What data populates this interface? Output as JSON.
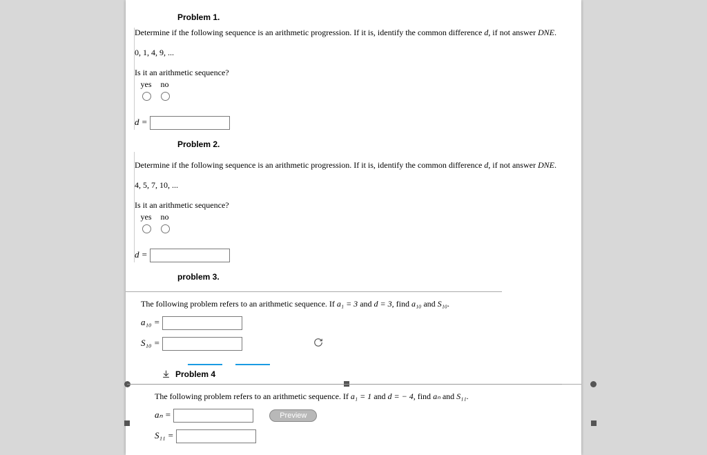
{
  "problem1": {
    "heading": "Problem 1.",
    "text_a": "Determine if the following sequence is an arithmetic progression. If it is, identify the common difference ",
    "d": "d",
    "text_b": ", if not answer ",
    "dne": "DNE",
    "period": ".",
    "sequence": "0, 1, 4, 9, ...",
    "question": "Is it an arithmetic sequence?",
    "yes": "yes",
    "no": "no",
    "dlabel": "d ="
  },
  "problem2": {
    "heading": "Problem 2.",
    "text_a": "Determine if the following sequence is an arithmetic progression. If it is, identify the common difference ",
    "d": "d",
    "text_b": ", if not answer ",
    "dne": "DNE",
    "period": ".",
    "sequence": "4, 5, 7, 10, ...",
    "question": "Is it an arithmetic sequence?",
    "yes": "yes",
    "no": "no",
    "dlabel": "d ="
  },
  "problem3": {
    "heading": "problem 3.",
    "text_a": "The following problem refers to an arithmetic sequence. If ",
    "a1_expr": "a₁ = 3",
    "and1": " and ",
    "d_expr": "d = 3",
    "find": ", find ",
    "a10": "a₁₀",
    "and2": " and ",
    "s10": "S₁₀",
    "period": ".",
    "a10_label": "a₁₀ =",
    "s10_label": "S₁₀ ="
  },
  "problem4": {
    "heading": "Problem 4",
    "text_a": "The following problem refers to an arithmetic sequence. If ",
    "a1_expr": "a₁ = 1",
    "and1": " and ",
    "d_expr": "d = − 4",
    "find": ", find ",
    "an": "aₙ",
    "and2": " and ",
    "s11": "S₁₁",
    "period": ".",
    "an_label": "aₙ =",
    "s11_label": "S₁₁ =",
    "preview": "Preview"
  }
}
